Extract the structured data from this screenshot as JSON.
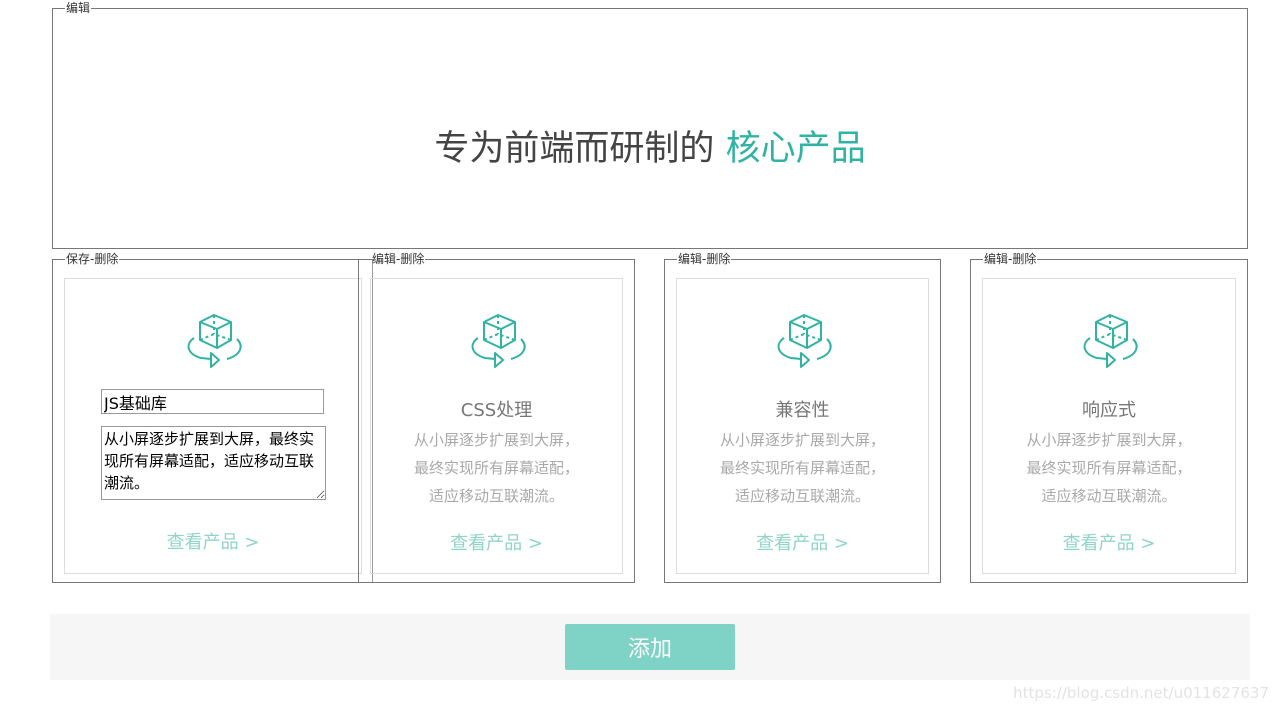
{
  "banner": {
    "legend": "编辑",
    "headline_main": "专为前端而研制的",
    "headline_accent": "核心产品"
  },
  "cards": [
    {
      "legend_left": "保存",
      "legend_sep": "-",
      "legend_right": "删除",
      "title_value": "JS基础库",
      "desc_value": "从小屏逐步扩展到大屏，最终实现所有屏幕适配，适应移动互联潮流。",
      "link": "查看产品 >"
    },
    {
      "legend_left": "编辑",
      "legend_sep": "-",
      "legend_right": "删除",
      "title": "CSS处理",
      "desc_lines": [
        "从小屏逐步扩展到大屏，",
        "最终实现所有屏幕适配，",
        "适应移动互联潮流。"
      ],
      "link": "查看产品 >"
    },
    {
      "legend_left": "编辑",
      "legend_sep": "-",
      "legend_right": "删除",
      "title": "兼容性",
      "desc_lines": [
        "从小屏逐步扩展到大屏，",
        "最终实现所有屏幕适配，",
        "适应移动互联潮流。"
      ],
      "link": "查看产品 >"
    },
    {
      "legend_left": "编辑",
      "legend_sep": "-",
      "legend_right": "删除",
      "title": "响应式",
      "desc_lines": [
        "从小屏逐步扩展到大屏，",
        "最终实现所有屏幕适配，",
        "适应移动互联潮流。"
      ],
      "link": "查看产品 >"
    }
  ],
  "footer": {
    "add_label": "添加"
  },
  "watermark": "https://blog.csdn.net/u011627637",
  "colors": {
    "accent": "#31b3a3",
    "button": "#7ed3c6",
    "link": "#8fd4c8"
  },
  "icons": {
    "card": "rotating-cube-icon"
  }
}
